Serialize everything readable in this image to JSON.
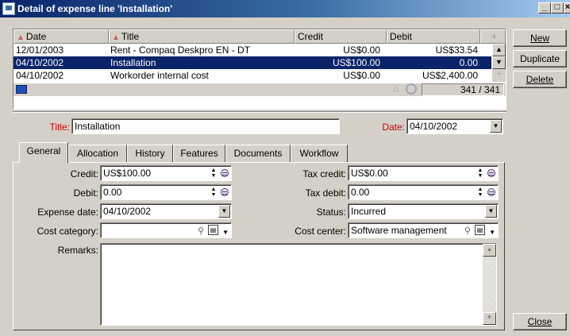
{
  "window": {
    "title": "Detail of expense line 'Installation'"
  },
  "buttons": {
    "new": "New",
    "duplicate": "Duplicate",
    "delete": "Delete",
    "close": "Close"
  },
  "list": {
    "columns": [
      "Date",
      "Title",
      "Credit",
      "Debit"
    ],
    "rows": [
      {
        "date": "12/01/2003",
        "title": "Rent - Compaq Deskpro EN - DT",
        "credit": "US$0.00",
        "debit": "US$33.54"
      },
      {
        "date": "04/10/2002",
        "title": "Installation",
        "credit": "US$100.00",
        "debit": "0.00"
      },
      {
        "date": "04/10/2002",
        "title": "Workorder internal cost",
        "credit": "US$0.00",
        "debit": "US$2,400.00"
      }
    ],
    "count": "341 / 341"
  },
  "form": {
    "title_label": "Title:",
    "title_value": "Installation",
    "date_label": "Date:",
    "date_value": "04/10/2002"
  },
  "tabs": [
    "General",
    "Allocation",
    "History",
    "Features",
    "Documents",
    "Workflow"
  ],
  "general": {
    "credit_label": "Credit:",
    "credit_value": "US$100.00",
    "debit_label": "Debit:",
    "debit_value": "0.00",
    "expense_date_label": "Expense date:",
    "expense_date_value": "04/10/2002",
    "cost_category_label": "Cost category:",
    "cost_category_value": "",
    "remarks_label": "Remarks:",
    "remarks_value": "",
    "tax_credit_label": "Tax credit:",
    "tax_credit_value": "US$0.00",
    "tax_debit_label": "Tax debit:",
    "tax_debit_value": "0.00",
    "status_label": "Status:",
    "status_value": "Incurred",
    "cost_center_label": "Cost center:",
    "cost_center_value": "Software management"
  },
  "colors": {
    "title_gradient_start": "#0a246a",
    "selection": "#0a246a",
    "required_label": "#d00000",
    "face": "#d4d0c8"
  }
}
